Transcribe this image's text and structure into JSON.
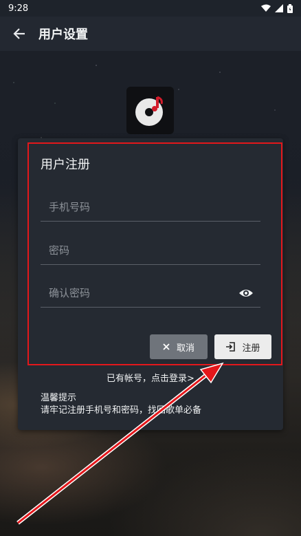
{
  "status_bar": {
    "time": "9:28"
  },
  "app_bar": {
    "title": "用户设置"
  },
  "dialog": {
    "title": "用户注册",
    "phone_placeholder": "手机号码",
    "password_placeholder": "密码",
    "confirm_placeholder": "确认密码",
    "cancel_label": "取消",
    "register_label": "注册",
    "login_link": "已有帐号，点击登录>",
    "tip_title": "温馨提示",
    "tip_text": "请牢记注册手机号和密码，找回歌单必备"
  },
  "colors": {
    "highlight": "#e4171b",
    "arrow": "#e4171b",
    "card_bg": "#252a32",
    "cancel_bg": "#6f747b",
    "register_bg": "#ececec"
  },
  "icons": [
    "back-arrow-icon",
    "wifi-icon",
    "signal-icon",
    "battery-icon",
    "music-disc-icon",
    "close-icon",
    "login-icon",
    "eye-icon"
  ]
}
